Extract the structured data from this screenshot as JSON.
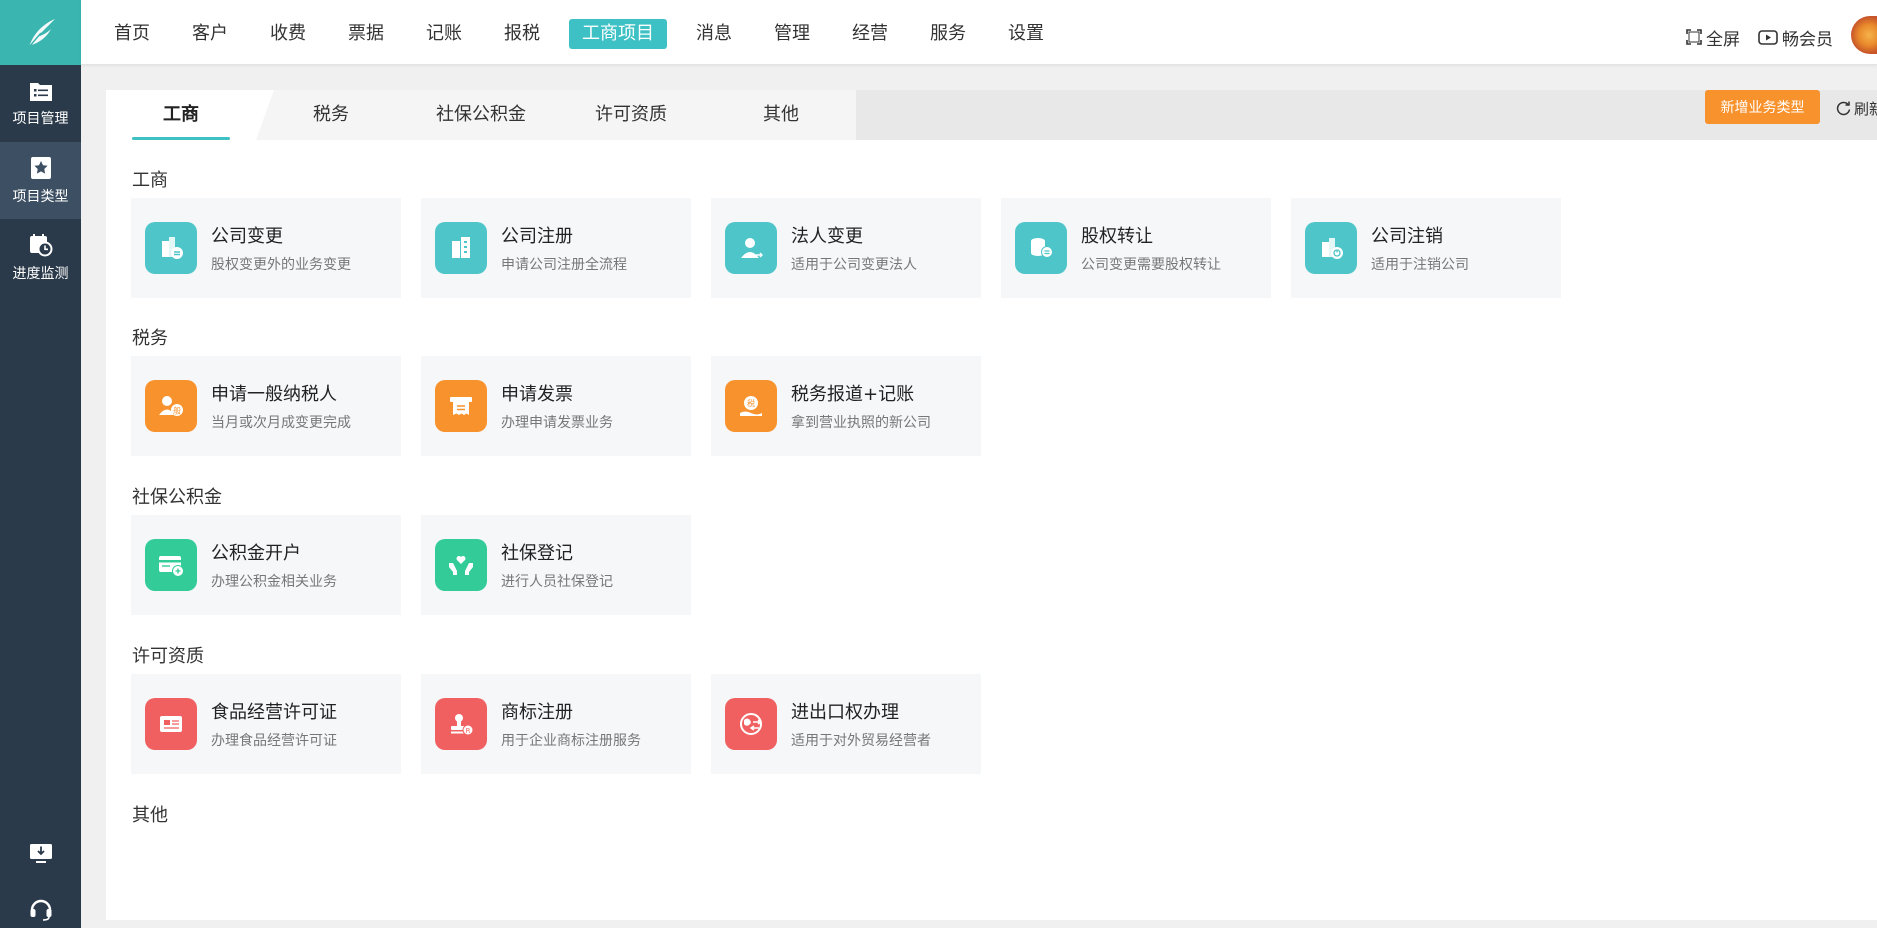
{
  "colors": {
    "sidebar_bg": "#2b3a4a",
    "logo_bg": "#3ab5b0",
    "accent": "#3ec1c4",
    "orange": "#f7922d",
    "teal_icon": "#4ec5c8",
    "orange_icon": "#f7922d",
    "green_icon": "#33cc99",
    "red_icon": "#f06060"
  },
  "sidebar": {
    "items": [
      {
        "label": "项目管理",
        "icon": "folder-list-icon"
      },
      {
        "label": "项目类型",
        "icon": "star-bookmark-icon"
      },
      {
        "label": "进度监测",
        "icon": "calendar-clock-icon"
      }
    ],
    "bottom": [
      {
        "icon": "download-monitor-icon"
      },
      {
        "icon": "headset-support-icon"
      }
    ]
  },
  "topnav": {
    "items": [
      "首页",
      "客户",
      "收费",
      "票据",
      "记账",
      "报税",
      "工商项目",
      "消息",
      "管理",
      "经营",
      "服务",
      "设置"
    ],
    "active_index": 6,
    "fullscreen": "全屏",
    "member": "畅会员"
  },
  "tabs": {
    "items": [
      "工商",
      "税务",
      "社保公积金",
      "许可资质",
      "其他"
    ],
    "active_index": 0
  },
  "actions": {
    "add_type": "新增业务类型",
    "refresh": "刷新"
  },
  "sections": [
    {
      "title": "工商",
      "cards": [
        {
          "title": "公司变更",
          "desc": "股权变更外的业务变更",
          "icon": "building-change-icon",
          "color": "#4ec5c8"
        },
        {
          "title": "公司注册",
          "desc": "申请公司注册全流程",
          "icon": "building-register-icon",
          "color": "#4ec5c8"
        },
        {
          "title": "法人变更",
          "desc": "适用于公司变更法人",
          "icon": "person-change-icon",
          "color": "#4ec5c8"
        },
        {
          "title": "股权转让",
          "desc": "公司变更需要股权转让",
          "icon": "coins-transfer-icon",
          "color": "#4ec5c8"
        },
        {
          "title": "公司注销",
          "desc": "适用于注销公司",
          "icon": "building-cancel-icon",
          "color": "#4ec5c8"
        }
      ]
    },
    {
      "title": "税务",
      "cards": [
        {
          "title": "申请一般纳税人",
          "desc": "当月或次月成变更完成",
          "icon": "taxpayer-icon",
          "color": "#f7922d"
        },
        {
          "title": "申请发票",
          "desc": "办理申请发票业务",
          "icon": "invoice-icon",
          "color": "#f7922d"
        },
        {
          "title": "税务报道+记账",
          "desc": "拿到营业执照的新公司",
          "icon": "tax-report-icon",
          "color": "#f7922d"
        }
      ]
    },
    {
      "title": "社保公积金",
      "cards": [
        {
          "title": "公积金开户",
          "desc": "办理公积金相关业务",
          "icon": "fund-card-icon",
          "color": "#33cc99"
        },
        {
          "title": "社保登记",
          "desc": "进行人员社保登记",
          "icon": "hands-heart-icon",
          "color": "#33cc99"
        }
      ]
    },
    {
      "title": "许可资质",
      "cards": [
        {
          "title": "食品经营许可证",
          "desc": "办理食品经营许可证",
          "icon": "license-card-icon",
          "color": "#f06060"
        },
        {
          "title": "商标注册",
          "desc": "用于企业商标注册服务",
          "icon": "trademark-stamp-icon",
          "color": "#f06060"
        },
        {
          "title": "进出口权办理",
          "desc": "适用于对外贸易经营者",
          "icon": "globe-trade-icon",
          "color": "#f06060"
        }
      ]
    },
    {
      "title": "其他",
      "cards": []
    }
  ]
}
